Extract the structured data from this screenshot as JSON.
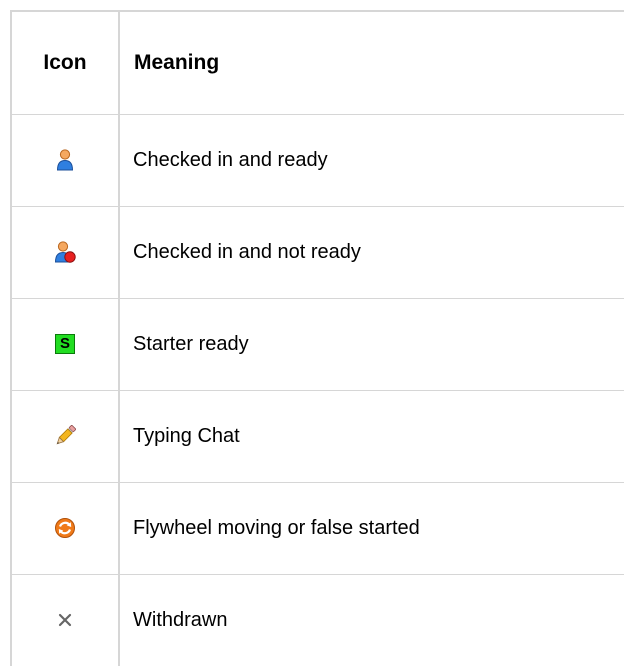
{
  "table": {
    "headers": {
      "icon": "Icon",
      "meaning": "Meaning"
    },
    "rows": [
      {
        "icon": "user-ready-icon",
        "meaning": "Checked in and ready"
      },
      {
        "icon": "user-not-ready-icon",
        "meaning": "Checked in and not ready"
      },
      {
        "icon": "starter-ready-icon",
        "icon_text": "S",
        "meaning": "Starter ready"
      },
      {
        "icon": "pencil-icon",
        "meaning": "Typing Chat"
      },
      {
        "icon": "refresh-icon",
        "meaning": "Flywheel moving or false started"
      },
      {
        "icon": "close-icon",
        "meaning": "Withdrawn"
      }
    ]
  },
  "colors": {
    "border": "#d6d6d6",
    "user_head": "#f5a860",
    "user_body": "#2f7fe0",
    "status_red": "#e82020",
    "starter_green": "#22dd22",
    "refresh_orange": "#f07a18",
    "withdrawn_gray": "#666666"
  }
}
